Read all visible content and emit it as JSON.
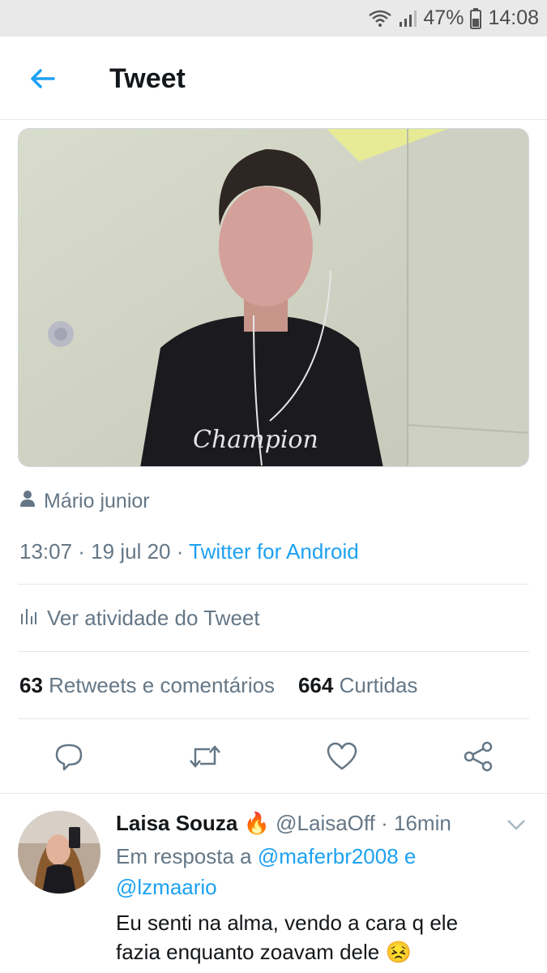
{
  "status_bar": {
    "battery": "47%",
    "time": "14:08"
  },
  "header": {
    "title": "Tweet",
    "back_icon": "arrow-left-icon"
  },
  "tweet": {
    "author_label": "Mário junior",
    "time": "13:07",
    "date": "19 jul 20",
    "source": "Twitter for Android",
    "separator": " · ",
    "activity_label": "Ver atividade do Tweet",
    "retweets_count": "63",
    "retweets_label": "Retweets e comentários",
    "likes_count": "664",
    "likes_label": "Curtidas"
  },
  "actions": [
    "reply-icon",
    "retweet-icon",
    "like-icon",
    "share-icon"
  ],
  "reply": {
    "name": "Laisa Souza",
    "emoji": "🔥",
    "handle": "@LaisaOff",
    "time": "16min",
    "in_reply_prefix": "Em resposta a",
    "mention_1": "@maferbr2008",
    "conjunction": "e",
    "mention_2": "@lzmaario",
    "text": "Eu senti na alma, vendo a cara q ele fazia enquanto zoavam dele",
    "text_emoji": "😣"
  },
  "media_text": {
    "shirt_text": "Champion"
  },
  "colors": {
    "accent": "#1da1f2",
    "muted": "#657786",
    "text": "#14171a",
    "divider": "#e1e8ed"
  }
}
